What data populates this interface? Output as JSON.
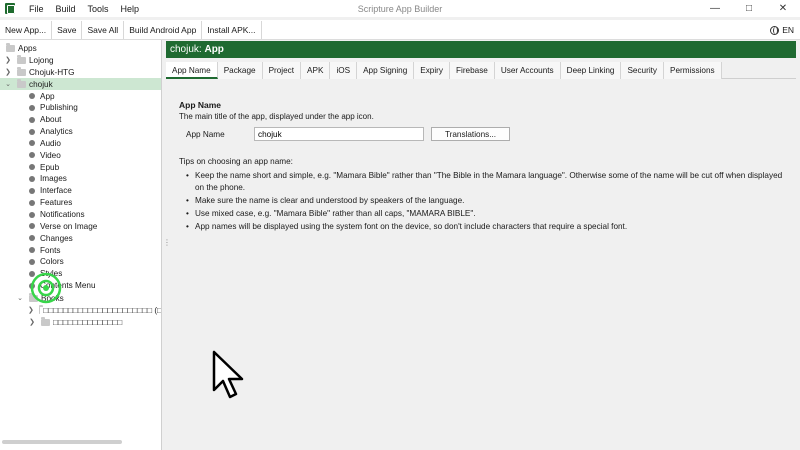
{
  "window": {
    "title": "Scripture App Builder"
  },
  "menu": [
    "File",
    "Build",
    "Tools",
    "Help"
  ],
  "toolbar": {
    "buttons": [
      "New App...",
      "Save",
      "Save All",
      "Build Android App",
      "Install APK..."
    ],
    "language": "EN"
  },
  "tree": {
    "root": "Apps",
    "apps": [
      "Lojong",
      "Chojuk-HTG",
      "chojuk"
    ],
    "selected_app_children": [
      "App",
      "Publishing",
      "About",
      "Analytics",
      "Audio",
      "Video",
      "Epub",
      "Images",
      "Interface",
      "Features",
      "Notifications",
      "Verse on Image",
      "Changes",
      "Fonts",
      "Colors",
      "Styles",
      "Contents Menu"
    ],
    "books_label": "Books",
    "books": [
      "□□□□□□□□□□□□□□□□□□□□□□ (□",
      "□□□□□□□□□□□□□□"
    ]
  },
  "header": {
    "project": "chojuk:",
    "view": "App"
  },
  "tabs": [
    "App Name",
    "Package",
    "Project",
    "APK",
    "iOS",
    "App Signing",
    "Expiry",
    "Firebase",
    "User Accounts",
    "Deep Linking",
    "Security",
    "Permissions"
  ],
  "active_tab": "App Name",
  "app_name": {
    "title": "App Name",
    "description": "The main title of the app, displayed under the app icon.",
    "label": "App Name",
    "value": "chojuk",
    "translations_button": "Translations..."
  },
  "tips": {
    "title": "Tips on choosing an app name:",
    "items": [
      "Keep the name short and simple, e.g. \"Mamara Bible\" rather than \"The Bible in the Mamara language\". Otherwise some of the name will be cut off when displayed on the phone.",
      "Make sure the name is clear and understood by speakers of the language.",
      "Use mixed case, e.g. \"Mamara Bible\" rather than all caps, \"MAMARA BIBLE\".",
      "App names will be displayed using the system font on the device, so don't include characters that require a special font."
    ]
  },
  "colors": {
    "accent": "#1f6a31",
    "selection": "#cde7d2",
    "click_ring": "#38d64a"
  }
}
